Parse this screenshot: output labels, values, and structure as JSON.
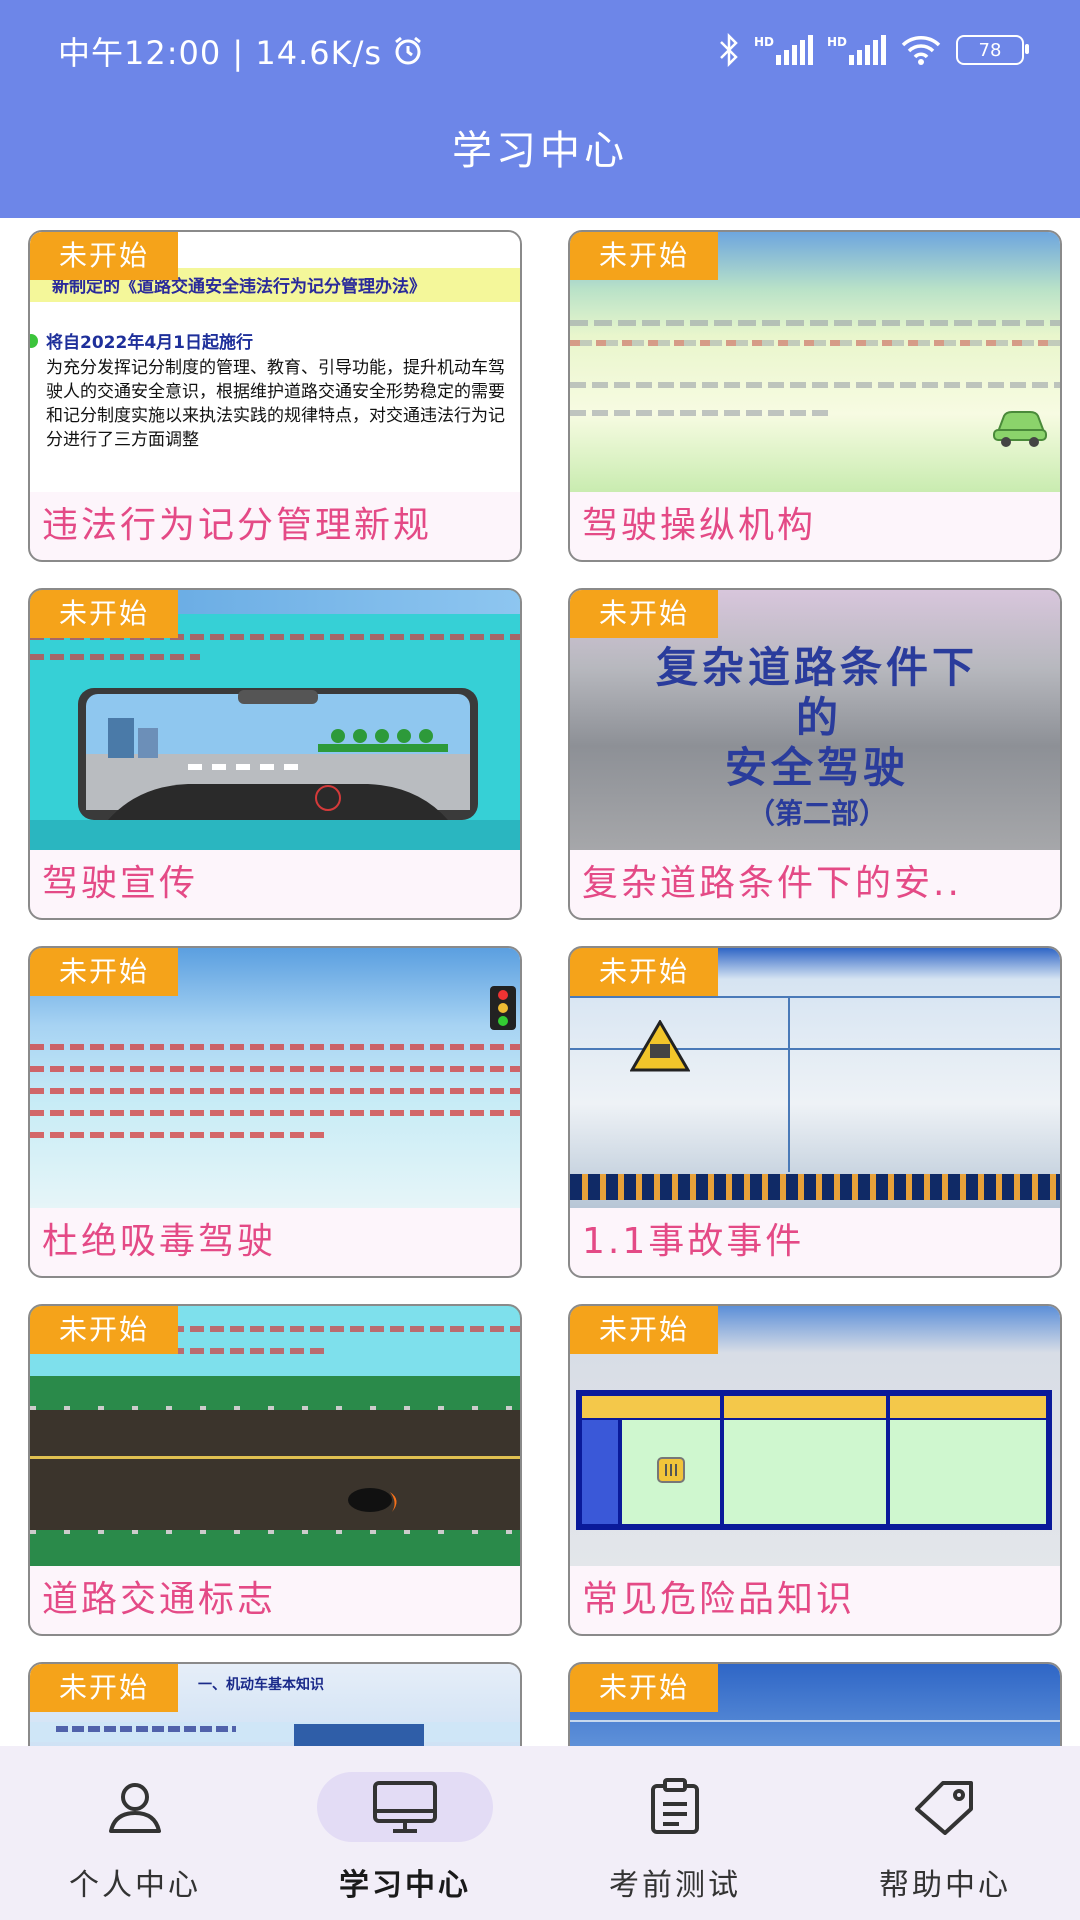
{
  "status_bar": {
    "time": "中午12:00 | 14.6K/s",
    "battery": "78",
    "hd1": "HD",
    "hd2": "HD",
    "icons": [
      "alarm-icon",
      "bluetooth-icon",
      "signal-icon",
      "signal-icon",
      "wifi-icon",
      "battery-icon"
    ]
  },
  "header": {
    "title": "学习中心"
  },
  "courses": [
    {
      "badge": "未开始",
      "title": "违法行为记分管理新规",
      "thumb": {
        "banner": "新制定的《道路交通安全违法行为记分管理办法》",
        "date": "将自2022年4月1日起施行",
        "body": "为充分发挥记分制度的管理、教育、引导功能，提升机动车驾驶人的交通安全意识，根据维护道路交通安全形势稳定的需要和记分制度实施以来执法实践的规律特点，对交通违法行为记分进行了三方面调整"
      }
    },
    {
      "badge": "未开始",
      "title": "驾驶操纵机构"
    },
    {
      "badge": "未开始",
      "title": "驾驶宣传"
    },
    {
      "badge": "未开始",
      "title": "复杂道路条件下的安..",
      "thumb": {
        "line1": "复杂道路条件下",
        "line2": "的",
        "line3": "安全驾驶",
        "line4": "（第二部）"
      }
    },
    {
      "badge": "未开始",
      "title": "杜绝吸毒驾驶"
    },
    {
      "badge": "未开始",
      "title": "1.1事故事件"
    },
    {
      "badge": "未开始",
      "title": "道路交通标志"
    },
    {
      "badge": "未开始",
      "title": "常见危险品知识"
    },
    {
      "badge": "未开始",
      "title": "",
      "thumb": {
        "heading": "一、机动车基本知识"
      }
    },
    {
      "badge": "未开始",
      "title": ""
    }
  ],
  "bottom_nav": [
    {
      "label": "个人中心",
      "icon": "user-icon",
      "active": false
    },
    {
      "label": "学习中心",
      "icon": "monitor-icon",
      "active": true
    },
    {
      "label": "考前测试",
      "icon": "clipboard-icon",
      "active": false
    },
    {
      "label": "帮助中心",
      "icon": "tag-icon",
      "active": false
    }
  ],
  "colors": {
    "header": "#6d86e8",
    "badge": "#f5a31a",
    "card_title": "#e44a86",
    "nav_bg": "#f2eef8"
  }
}
